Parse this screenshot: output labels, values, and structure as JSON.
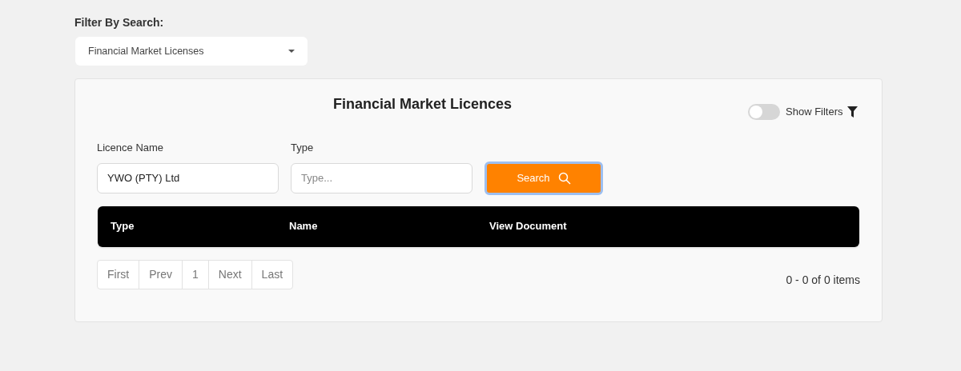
{
  "filter": {
    "label": "Filter By Search:",
    "value": "Financial Market Licenses"
  },
  "panel": {
    "title": "Financial Market Licences",
    "show_filters": {
      "label": "Show Filters",
      "on": false
    },
    "fields": [
      {
        "label": "Licence Name",
        "value": "YWO (PTY) Ltd"
      },
      {
        "label": "Type",
        "placeholder": "Type..."
      }
    ],
    "search_button": "Search",
    "table": {
      "columns": [
        "Type",
        "Name",
        "View Document"
      ]
    },
    "pagination": [
      "First",
      "Prev",
      "1",
      "Next",
      "Last"
    ],
    "summary": "0 - 0 of 0 items"
  }
}
